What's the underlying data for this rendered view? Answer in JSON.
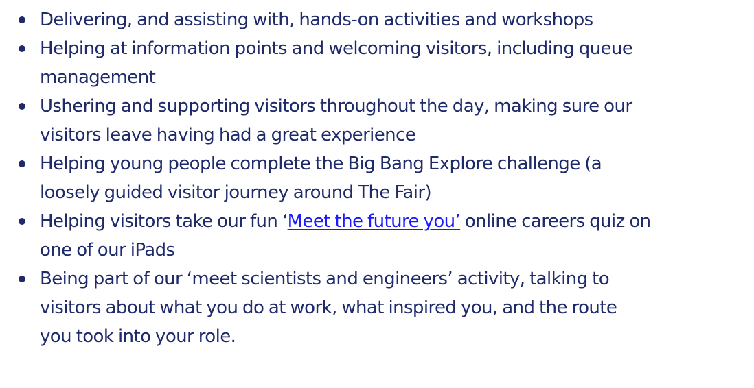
{
  "colors": {
    "text": "#1f2a6b",
    "link": "#1a1aff"
  },
  "items": [
    {
      "line1": "Delivering, and assisting with, hands-on activities and workshops"
    },
    {
      "line1": "Helping at information points and welcoming visitors, including queue",
      "line2": "management"
    },
    {
      "line1": "Ushering and supporting visitors throughout the day, making sure our",
      "line2": "visitors leave having had a great experience"
    },
    {
      "line1": "Helping young people complete the Big Bang Explore challenge (a",
      "line2": "loosely guided visitor journey around The Fair)"
    },
    {
      "line1_before": "Helping visitors take our fun ‘",
      "link": "Meet the future you’",
      "line1_after": " online careers quiz on",
      "line2": "one of our iPads"
    },
    {
      "line1": "Being part of our ‘meet scientists and engineers’ activity, talking to",
      "line2": "visitors about what you do at work, what inspired you, and the route",
      "line3": "you took into your role."
    }
  ]
}
